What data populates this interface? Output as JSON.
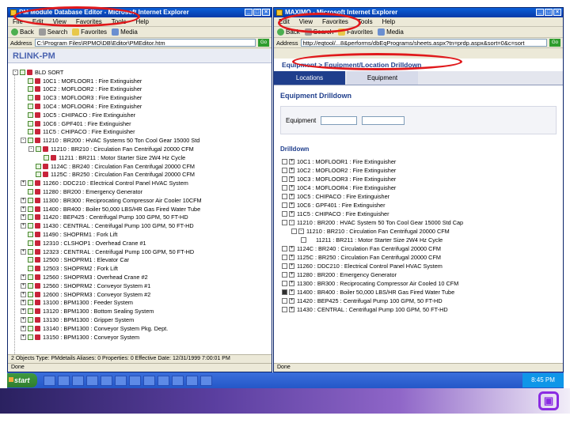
{
  "left_window": {
    "title": "PM Module Database Editor - Microsoft Internet Explorer",
    "menu": [
      "File",
      "Edit",
      "View",
      "Favorites",
      "Tools",
      "Help"
    ],
    "toolbar": [
      "Back",
      "Search",
      "Favorites",
      "Media"
    ],
    "address_label": "Address",
    "address": "C:\\Program Files\\RPMO\\DB\\Editor\\PMEditor.htm",
    "go_label": "Go",
    "app_title": "RLINK-PM",
    "tree_root": "BLD SORT",
    "tree_rows": [
      {
        "text": "10C1 : MOFLOOR1 : Fire Extinguisher",
        "indent": 1,
        "exp": ""
      },
      {
        "text": "10C2 : MOFLOOR2 : Fire Extinguisher",
        "indent": 1,
        "exp": ""
      },
      {
        "text": "10C3 : MOFLOOR3 : Fire Extinguisher",
        "indent": 1,
        "exp": ""
      },
      {
        "text": "10C4 : MOFLOOR4 : Fire Extinguisher",
        "indent": 1,
        "exp": ""
      },
      {
        "text": "10C5 : CHIPACO : Fire Extinguisher",
        "indent": 1,
        "exp": ""
      },
      {
        "text": "10C6 : GPF401 : Fire Extinguisher",
        "indent": 1,
        "exp": ""
      },
      {
        "text": "11C5 : CHIPACO : Fire Extinguisher",
        "indent": 1,
        "exp": ""
      },
      {
        "text": "11210 : BR200 : HVAC Systems 50 Ton Cool Gear 15000 Std",
        "indent": 1,
        "exp": "-"
      },
      {
        "text": "11210 : BR210 : Circulation Fan Centrifugal 20000 CFM",
        "indent": 2,
        "exp": "-"
      },
      {
        "text": "11211 : BR211 : Motor Starter Size 2W4 Hz Cycle",
        "indent": 3,
        "exp": ""
      },
      {
        "text": "1124C : BR240 : Circulation Fan Centrifugal 20000 CFM",
        "indent": 2,
        "exp": ""
      },
      {
        "text": "1125C : BR250 : Circulation Fan Centrifugal 20000 CFM",
        "indent": 2,
        "exp": ""
      },
      {
        "text": "11260 : DDC210 : Electrical Control Panel HVAC System",
        "indent": 1,
        "exp": "+"
      },
      {
        "text": "11280 : BR200 : Emergency Generator",
        "indent": 1,
        "exp": ""
      },
      {
        "text": "11300 : BR300 : Reciprocating Compressor Air Cooler 10CFM",
        "indent": 1,
        "exp": "+"
      },
      {
        "text": "11400 : BR400 : Boiler 50,000 LBS/HR Gas Fired Water Tube",
        "indent": 1,
        "exp": "+"
      },
      {
        "text": "11420 : BEP425 : Centrifugal Pump 100 GPM, 50 FT-HD",
        "indent": 1,
        "exp": "+"
      },
      {
        "text": "11430 : CENTRAL : Centrifugal Pump 100 GPM, 50 FT-HD",
        "indent": 1,
        "exp": "+"
      },
      {
        "text": "11490 : SHOPRM1 : Fork Lift",
        "indent": 1,
        "exp": ""
      },
      {
        "text": "12310 : CLSHOP1 : Overhead Crane #1",
        "indent": 1,
        "exp": ""
      },
      {
        "text": "12323 : CENTRAL : Centrifugal Pump 100 GPM, 50 FT-HD",
        "indent": 1,
        "exp": "+"
      },
      {
        "text": "12500 : SHOPRM1 : Elevator Car",
        "indent": 1,
        "exp": ""
      },
      {
        "text": "12503 : SHOPRM2 : Fork Lift",
        "indent": 1,
        "exp": ""
      },
      {
        "text": "12560 : SHOPRM3 : Overhead Crane #2",
        "indent": 1,
        "exp": "+"
      },
      {
        "text": "12560 : SHOPRM2 : Conveyor System #1",
        "indent": 1,
        "exp": "+"
      },
      {
        "text": "12600 : SHOPRM3 : Conveyor System #2",
        "indent": 1,
        "exp": "+"
      },
      {
        "text": "13100 : BPM1300 : Feeder System",
        "indent": 1,
        "exp": "+"
      },
      {
        "text": "13120 : BPM1300 : Bottom Sealing System",
        "indent": 1,
        "exp": "+"
      },
      {
        "text": "13130 : BPM1300 : Gripper System",
        "indent": 1,
        "exp": "+"
      },
      {
        "text": "13140 : BPM1300 : Conveyor System Pkg. Dept.",
        "indent": 1,
        "exp": "+"
      },
      {
        "text": "13150 : BPM1300 : Conveyor System",
        "indent": 1,
        "exp": "+"
      }
    ],
    "status_line1": "2 Objects   Type: PMdetails   Aliases: 0   Properties: 0   Effective Date: 12/31/1999 7:00:01 PM",
    "status_line2": "Done"
  },
  "right_window": {
    "title": "MAXIMO - Microsoft Internet Explorer",
    "menu": [
      "Edit",
      "View",
      "Favorites",
      "Tools",
      "Help"
    ],
    "toolbar": [
      "Back",
      "Search",
      "Favorites",
      "Media"
    ],
    "address_label": "Address",
    "address": "http://eqtool/...8&performs/dbEqPrograms/sheets.aspx?tn=prdp.aspx&sort=0&c=sort",
    "go_label": "Go",
    "breadcrumb": "Equipment > Equipment/Location Drilldown",
    "tabs": [
      "Locations",
      "Equipment"
    ],
    "section_title": "Equipment Drilldown",
    "form_label": "Equipment",
    "drilldown_label": "Drilldown",
    "rows": [
      {
        "text": "10C1 : MOFLOOR1 : Fire Extinguisher",
        "exp": "+",
        "checked": false
      },
      {
        "text": "10C2 : MOFLOOR2 : Fire Extinguisher",
        "exp": "+",
        "checked": false
      },
      {
        "text": "10C3 : MOFLOOR3 : Fire Extinguisher",
        "exp": "+",
        "checked": false
      },
      {
        "text": "10C4 : MOFLOOR4 : Fire Extinguisher",
        "exp": "+",
        "checked": false
      },
      {
        "text": "10C5 : CHIPACO : Fire Extinguisher",
        "exp": "+",
        "checked": false
      },
      {
        "text": "10C6 : GPF401 : Fire Extinguisher",
        "exp": "+",
        "checked": false
      },
      {
        "text": "11C5 : CHIPACO : Fire Extinguisher",
        "exp": "+",
        "checked": false
      },
      {
        "text": "11210 : BR200 : HVAC System 50 Ton Cool Gear 15000 Std Cap",
        "exp": "-",
        "checked": false
      },
      {
        "text": "11210 : BR210 : Circulation Fan Centrifugal 20000 CFM",
        "exp": "-",
        "checked": false
      },
      {
        "text": "11211 : BR211 : Motor Starter Size 2W4 Hz Cycle",
        "exp": "",
        "checked": false
      },
      {
        "text": "1124C : BR240 : Circulation Fan Centrifugal 20000 CFM",
        "exp": "+",
        "checked": false
      },
      {
        "text": "1125C : BR250 : Circulation Fan Centrifugal 20000 CFM",
        "exp": "+",
        "checked": false
      },
      {
        "text": "11260 : DDC210 : Electrical Control Panel HVAC System",
        "exp": "+",
        "checked": false
      },
      {
        "text": "11280 : BR200 : Emergency Generator",
        "exp": "+",
        "checked": false
      },
      {
        "text": "11300 : BR300 : Reciprocating Compressor Air Cooled 10 CFM",
        "exp": "+",
        "checked": false
      },
      {
        "text": "11400 : BR400 : Boiler 50,000 LBS/HR Gas Fired Water Tube",
        "exp": "+",
        "checked": true
      },
      {
        "text": "11420 : BEP425 : Centrifugal Pump 100 GPM, 50 FT-HD",
        "exp": "+",
        "checked": false
      },
      {
        "text": "11430 : CENTRAL : Centrifugal Pump 100 GPM, 50 FT-HD",
        "exp": "+",
        "checked": false
      }
    ],
    "status": "Done"
  },
  "taskbar": {
    "start": "start",
    "clock": "8:45 PM"
  },
  "colors": {
    "highlight": "#e0181b",
    "xp_blue": "#0a5fd8",
    "rlink_text": "#4a63b0",
    "maximo_tab": "#1f3e8c"
  }
}
